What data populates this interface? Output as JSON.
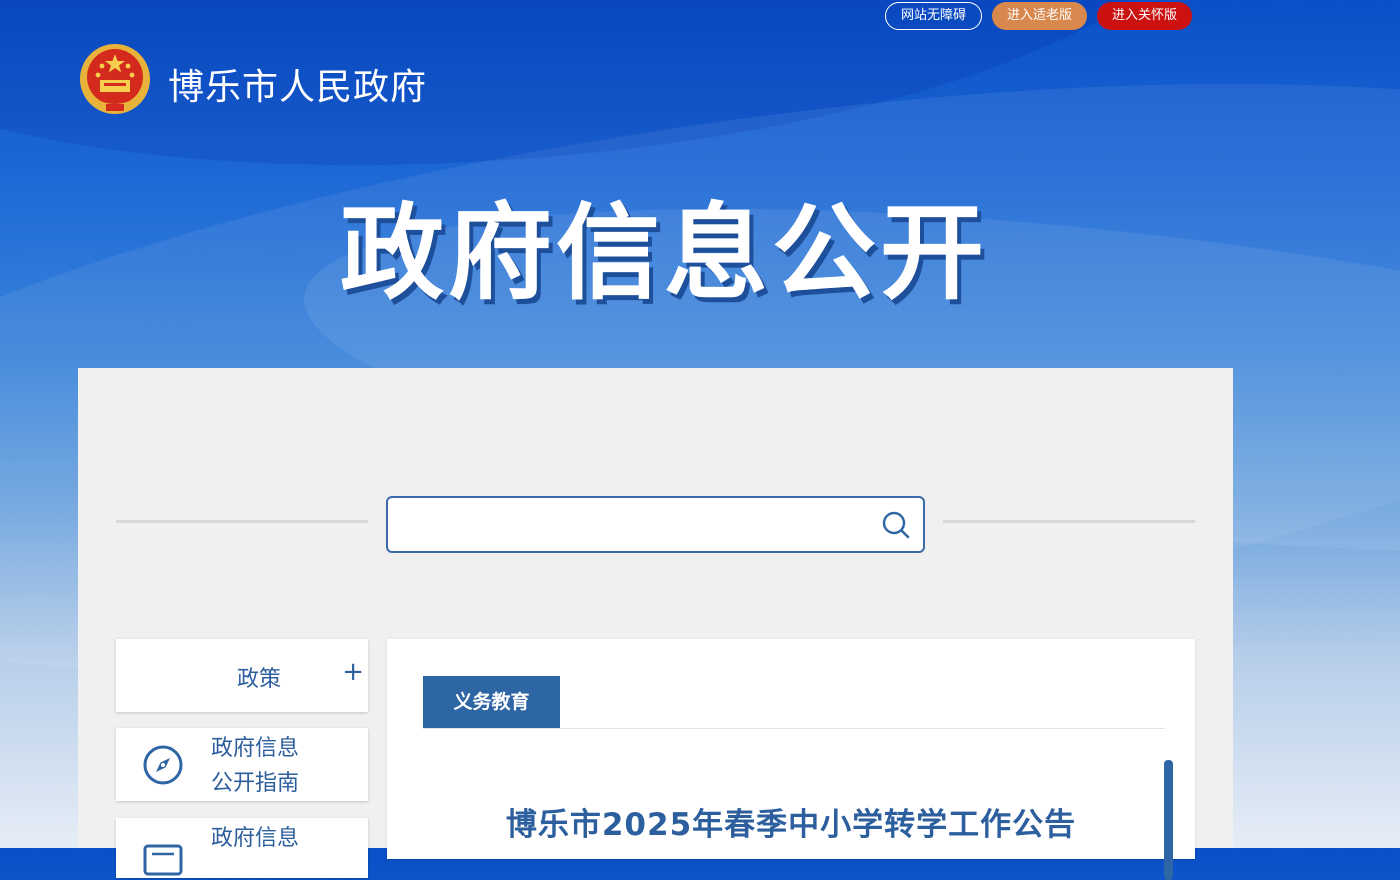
{
  "header": {
    "site_name": "博乐市人民政府",
    "top_buttons": {
      "accessible": "网站无障碍",
      "elderly": "进入适老版",
      "care": "进入关怀版"
    }
  },
  "hero": {
    "title": "政府信息公开"
  },
  "search": {
    "placeholder": "",
    "value": ""
  },
  "sidebar": {
    "items": [
      {
        "label": "政策",
        "expand": "+"
      },
      {
        "label_line1": "政府信息",
        "label_line2": "公开指南",
        "icon": "compass-icon"
      },
      {
        "label_line1": "政府信息",
        "icon": "document-icon"
      }
    ]
  },
  "content": {
    "tab": "义务教育",
    "article_title": "博乐市2025年春季中小学转学工作公告"
  },
  "colors": {
    "primary": "#2e65a4",
    "care_button": "#cc1111",
    "elderly_button": "#d9884d"
  }
}
